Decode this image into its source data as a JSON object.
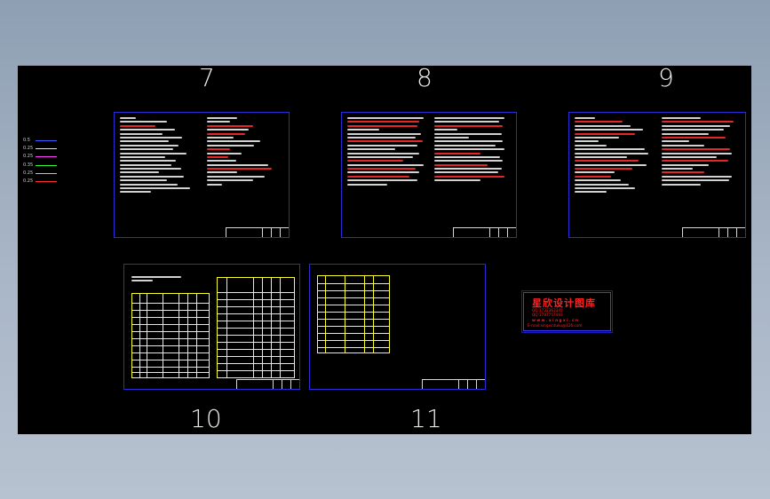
{
  "sheet_numbers": {
    "s7": "7",
    "s8": "8",
    "s9": "9",
    "s10": "10",
    "s11": "11"
  },
  "layers": [
    {
      "label": "0.5",
      "color": "#3a5cff"
    },
    {
      "label": "0.25",
      "color": "#ffff30"
    },
    {
      "label": "0.25",
      "color": "#ff40ff"
    },
    {
      "label": "0.35",
      "color": "#30ff30"
    },
    {
      "label": "0.25",
      "color": "#30ffff"
    },
    {
      "label": "0.25",
      "color": "#ff3030"
    }
  ],
  "stamp": {
    "title": "星欣设计图库",
    "line1": "QQ:1732363345",
    "line2": "QQ:1787757493",
    "line3": "w w w . x i n g x i . c n",
    "line4": "E-mail:xingxintuku@126.com"
  }
}
